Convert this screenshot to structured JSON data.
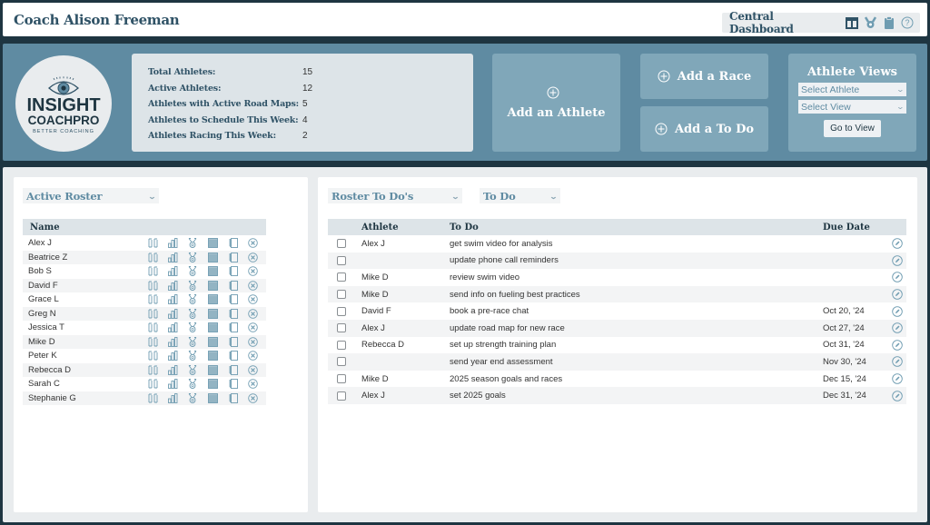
{
  "header": {
    "title": "Coach Alison Freeman",
    "nav_label": "Central Dashboard",
    "nav_icons": [
      "layout-columns-icon",
      "medal-icon",
      "clipboard-icon",
      "help-icon"
    ]
  },
  "logo": {
    "line1": "INSIGHT",
    "line2": "COACHPRO",
    "tagline": "BETTER COACHING"
  },
  "stats": [
    {
      "label": "Total Athletes:",
      "value": "15"
    },
    {
      "label": "Active Athletes:",
      "value": "12"
    },
    {
      "label": "Athletes with Active Road Maps:",
      "value": "5"
    },
    {
      "label": "Athletes to Schedule This Week:",
      "value": "4"
    },
    {
      "label": "Athletes Racing This Week:",
      "value": "2"
    }
  ],
  "actions": {
    "add_athlete": "Add an Athlete",
    "add_race": "Add a Race",
    "add_todo": "Add a To Do"
  },
  "athlete_views": {
    "title": "Athlete Views",
    "select_athlete": "Select Athlete",
    "select_view": "Select View",
    "go_button": "Go to View"
  },
  "roster": {
    "filter": "Active Roster",
    "column_name": "Name",
    "row_icons": [
      "road-map-icon",
      "stats-chart-icon",
      "medal-icon",
      "notes-icon",
      "notebook-icon",
      "remove-icon"
    ],
    "athletes": [
      "Alex J",
      "Beatrice Z",
      "Bob S",
      "David F",
      "Grace L",
      "Greg N",
      "Jessica T",
      "Mike D",
      "Peter K",
      "Rebecca D",
      "Sarah C",
      "Stephanie G"
    ]
  },
  "todos": {
    "filter": "Roster To Do's",
    "status_filter": "To Do",
    "columns": {
      "athlete": "Athlete",
      "todo": "To Do",
      "due": "Due Date"
    },
    "rows": [
      {
        "athlete": "Alex J",
        "todo": "get swim video for analysis",
        "due": ""
      },
      {
        "athlete": "",
        "todo": "update phone call reminders",
        "due": ""
      },
      {
        "athlete": "Mike D",
        "todo": "review swim video",
        "due": ""
      },
      {
        "athlete": "Mike D",
        "todo": "send info on fueling best practices",
        "due": ""
      },
      {
        "athlete": "David F",
        "todo": "book a pre-race chat",
        "due": "Oct 20, '24"
      },
      {
        "athlete": "Alex J",
        "todo": "update road map for new race",
        "due": "Oct 27, '24"
      },
      {
        "athlete": "Rebecca D",
        "todo": "set up strength training plan",
        "due": "Oct 31, '24"
      },
      {
        "athlete": "",
        "todo": "send year end assessment",
        "due": "Nov 30, '24"
      },
      {
        "athlete": "Mike D",
        "todo": "2025 season goals and races",
        "due": "Dec 15, '24"
      },
      {
        "athlete": "Alex J",
        "todo": "set 2025 goals",
        "due": "Dec 31, '24"
      }
    ]
  }
}
